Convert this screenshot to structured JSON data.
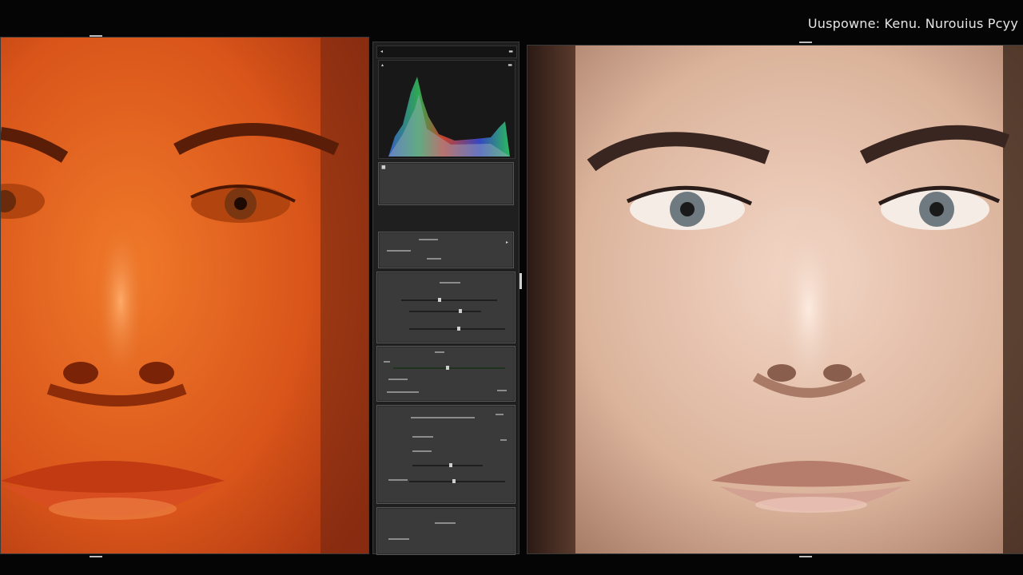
{
  "header": {
    "brand_text": "Uuspowne: Kenu. Nurouius Pcyy"
  },
  "panels": {
    "before_label": "",
    "after_label": ""
  },
  "editor": {
    "sections": [
      {
        "name": "histogram"
      },
      {
        "name": "basic-adjustments"
      },
      {
        "name": "tone-curve"
      },
      {
        "name": "hsl"
      },
      {
        "name": "detail"
      },
      {
        "name": "effects"
      }
    ]
  },
  "colors": {
    "background": "#050505",
    "panel": "#1f1f1f",
    "section": "#3a3a3a",
    "before_tint": "#e0641c",
    "after_skin": "#d9b49c"
  }
}
